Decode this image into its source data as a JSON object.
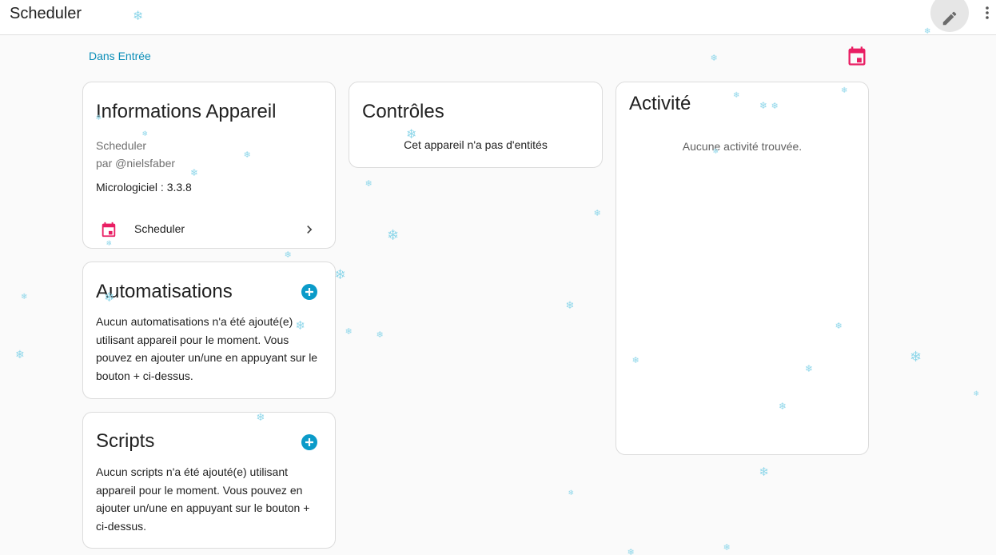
{
  "header": {
    "title": "Scheduler",
    "edit_icon": "pencil-icon",
    "more_icon": "dots-vertical-icon"
  },
  "breadcrumb": {
    "label": "Dans Entrée",
    "calendar_icon": "calendar-icon"
  },
  "device_info": {
    "title": "Informations Appareil",
    "model": "Scheduler",
    "author": "par @nielsfaber",
    "firmware": "Micrologiciel : 3.3.8",
    "integration": {
      "label": "Scheduler",
      "icon": "calendar-icon",
      "chevron": "chevron-right-icon"
    }
  },
  "automations": {
    "title": "Automatisations",
    "empty_text": "Aucun automatisations n'a été ajouté(e) utilisant appareil pour le moment. Vous pouvez en ajouter un/une en appuyant sur le bouton + ci-dessus."
  },
  "scripts": {
    "title": "Scripts",
    "empty_text": "Aucun scripts n'a été ajouté(e) utilisant appareil pour le moment. Vous pouvez en ajouter un/une en appuyant sur le bouton + ci-dessus."
  },
  "controls": {
    "title": "Contrôles",
    "empty_text": "Cet appareil n'a pas d'entités"
  },
  "activity": {
    "title": "Activité",
    "empty_text": "Aucune activité trouvée."
  },
  "colors": {
    "accent": "#0b9bc9",
    "link": "#0b8eb8",
    "calendar": "#e91e63",
    "snowflake": "#8fd7ea"
  },
  "decor": {
    "snowflake_icon": "❄"
  }
}
